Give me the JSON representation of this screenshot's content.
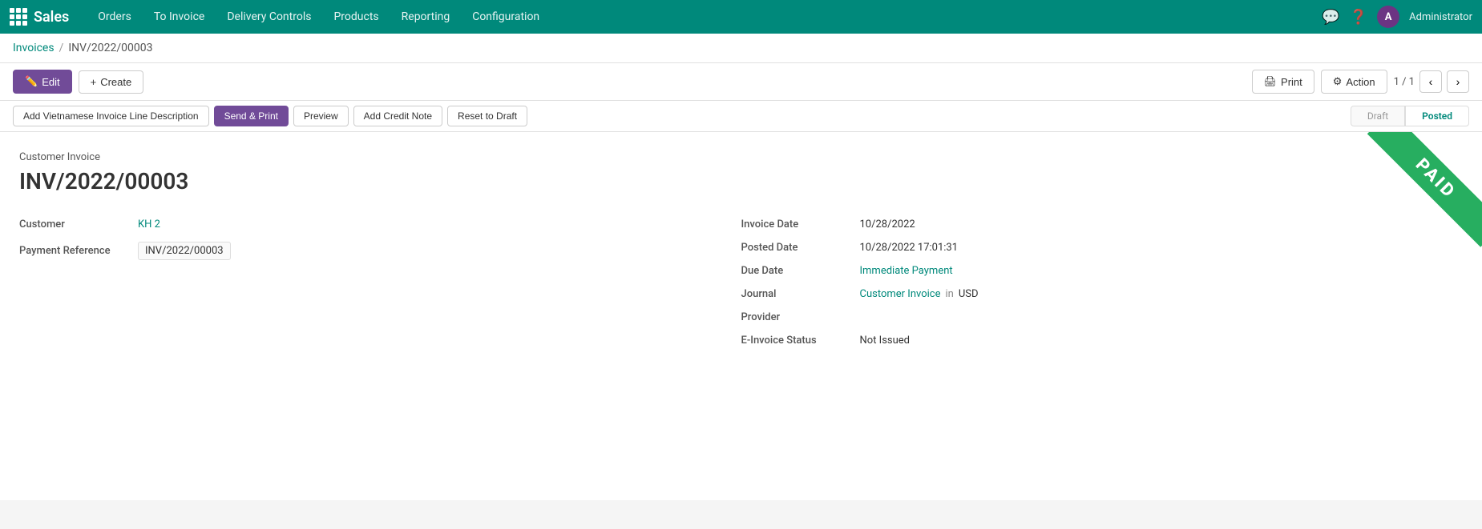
{
  "app": {
    "brand": "Sales"
  },
  "topnav": {
    "links": [
      {
        "id": "orders",
        "label": "Orders"
      },
      {
        "id": "to-invoice",
        "label": "To Invoice"
      },
      {
        "id": "delivery-controls",
        "label": "Delivery Controls"
      },
      {
        "id": "products",
        "label": "Products"
      },
      {
        "id": "reporting",
        "label": "Reporting"
      },
      {
        "id": "configuration",
        "label": "Configuration"
      }
    ],
    "admin_label": "Administrator"
  },
  "breadcrumb": {
    "parent": "Invoices",
    "current": "INV/2022/00003"
  },
  "toolbar": {
    "edit_label": "Edit",
    "create_label": "Create",
    "print_label": "Print",
    "action_label": "Action",
    "pagination": "1 / 1"
  },
  "workflow": {
    "add_vn_label": "Add Vietnamese Invoice Line Description",
    "send_print_label": "Send & Print",
    "preview_label": "Preview",
    "add_credit_label": "Add Credit Note",
    "reset_draft_label": "Reset to Draft",
    "status_steps": [
      {
        "id": "draft",
        "label": "Draft"
      },
      {
        "id": "posted",
        "label": "Posted"
      }
    ],
    "active_step": "posted"
  },
  "invoice": {
    "type_label": "Customer Invoice",
    "number": "INV/2022/00003",
    "paid_ribbon": "PAID"
  },
  "fields_left": {
    "customer_label": "Customer",
    "customer_value": "KH 2",
    "payment_ref_label": "Payment Reference",
    "payment_ref_value": "INV/2022/00003"
  },
  "fields_right": {
    "invoice_date_label": "Invoice Date",
    "invoice_date_value": "10/28/2022",
    "posted_date_label": "Posted Date",
    "posted_date_value": "10/28/2022 17:01:31",
    "due_date_label": "Due Date",
    "due_date_value": "Immediate Payment",
    "journal_label": "Journal",
    "journal_link": "Customer Invoice",
    "journal_in": "in",
    "journal_currency": "USD",
    "provider_label": "Provider",
    "provider_value": "",
    "e_invoice_label": "E-Invoice Status",
    "e_invoice_value": "Not Issued"
  }
}
